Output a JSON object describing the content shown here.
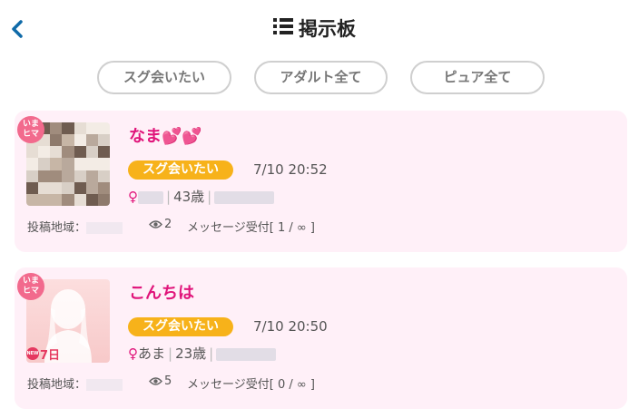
{
  "header": {
    "title": "掲示板"
  },
  "filters": [
    {
      "label": "スグ会いたい"
    },
    {
      "label": "アダルト全て"
    },
    {
      "label": "ピュア全て"
    }
  ],
  "posts": [
    {
      "status_badge": "いま\nヒマ",
      "title": "なま💕💕",
      "tag": "スグ会いたい",
      "time": "7/10 20:52",
      "gender_symbol": "♀",
      "nickname": "",
      "age": "43歳",
      "area_label": "投稿地域：",
      "views": "2",
      "message_status": "メッセージ受付[ 1 / ∞ ]"
    },
    {
      "status_badge": "いま\nヒマ",
      "title": "こんちは",
      "tag": "スグ会いたい",
      "time": "7/10 20:50",
      "gender_symbol": "♀",
      "nickname": "あま",
      "age": "23歳",
      "area_label": "投稿地域：",
      "views": "5",
      "message_status": "メッセージ受付[ 0 / ∞ ]",
      "new_badge": "NEW",
      "new_days": "7日"
    }
  ]
}
